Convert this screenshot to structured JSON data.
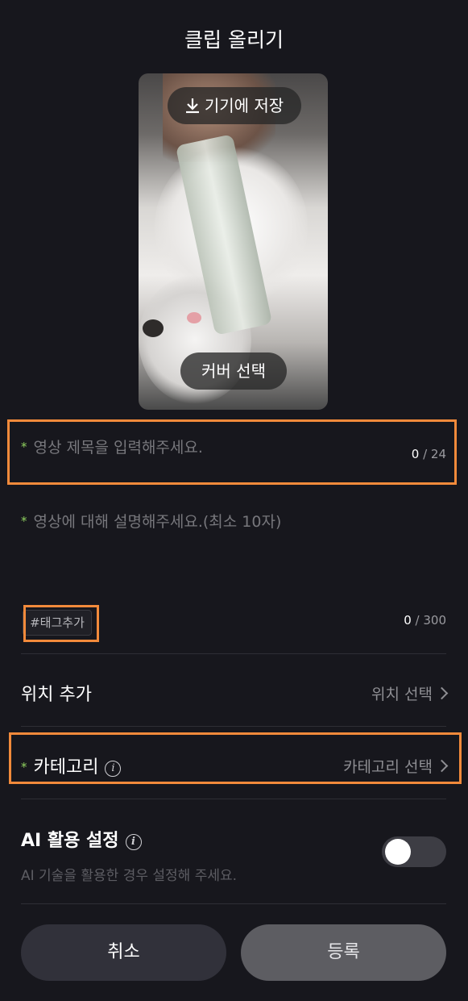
{
  "header": {
    "title": "클립 올리기"
  },
  "preview": {
    "save_label": "기기에 저장",
    "cover_label": "커버 선택",
    "icons": {
      "save": "download-icon"
    }
  },
  "form": {
    "title_placeholder": "영상 제목을 입력해주세요.",
    "title_count": "0",
    "title_max": "/ 24",
    "desc_placeholder": "영상에 대해 설명해주세요.(최소 10자)",
    "tag_label": "#태그추가",
    "desc_count": "0",
    "desc_max": "/ 300",
    "required_mark": "*"
  },
  "location": {
    "label": "위치 추가",
    "value": "위치 선택"
  },
  "category": {
    "label": "카테고리",
    "value": "카테고리 선택"
  },
  "ai": {
    "label": "AI 활용 설정",
    "help": "AI 기술을 활용한 경우 설정해 주세요.",
    "enabled": false
  },
  "buttons": {
    "cancel": "취소",
    "submit": "등록"
  },
  "colors": {
    "background": "#17171d",
    "required": "#8fd15f",
    "highlight": "#f28a3b"
  }
}
